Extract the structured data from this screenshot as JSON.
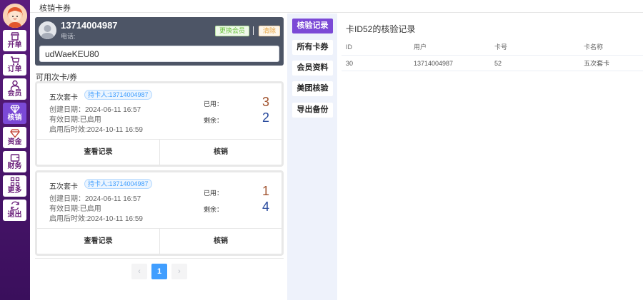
{
  "topbar": {
    "title": "核销卡券"
  },
  "sidebar": {
    "items": [
      {
        "label": "开单",
        "icon": "shop-icon"
      },
      {
        "label": "订单",
        "icon": "cart-icon"
      },
      {
        "label": "会员",
        "icon": "user-icon"
      },
      {
        "label": "核销",
        "icon": "diamond-icon",
        "active": true
      },
      {
        "label": "资金",
        "icon": "gem-icon"
      },
      {
        "label": "财务",
        "icon": "wallet-icon"
      },
      {
        "label": "更多",
        "icon": "grid-icon"
      },
      {
        "label": "退出",
        "icon": "refresh-icon"
      }
    ]
  },
  "member": {
    "phone": "13714004987",
    "tel_label": "电话:",
    "swap_label": "更换会员",
    "clear_label": "清除",
    "code_value": "udWaeKEU80"
  },
  "vouchers_section": {
    "label": "可用次卡/券"
  },
  "vouchers": [
    {
      "name": "五次套卡",
      "holder": "持卡人:13714004987",
      "created": "创建日期：2024-06-11 16:57",
      "valid": "有效日期:已启用",
      "expire": "启用后时效:2024-10-11 16:59",
      "used_label": "已用：",
      "used": "3",
      "remaining_label": "剩余：",
      "remaining": "2",
      "view_label": "查看记录",
      "redeem_label": "核销"
    },
    {
      "name": "五次套卡",
      "holder": "持卡人:13714004987",
      "created": "创建日期：2024-06-11 16:57",
      "valid": "有效日期:已启用",
      "expire": "启用后时效:2024-10-11 16:59",
      "used_label": "已用：",
      "used": "1",
      "remaining_label": "剩余：",
      "remaining": "4",
      "view_label": "查看记录",
      "redeem_label": "核销"
    }
  ],
  "pagination": {
    "prev": "‹",
    "current": "1",
    "next": "›"
  },
  "tabs": [
    {
      "label": "核验记录",
      "active": true
    },
    {
      "label": "所有卡券"
    },
    {
      "label": "会员资料"
    },
    {
      "label": "美团核验"
    },
    {
      "label": "导出备份"
    }
  ],
  "records": {
    "title": "卡ID52的核验记录",
    "columns": [
      "ID",
      "用户",
      "卡号",
      "卡名称"
    ],
    "rows": [
      [
        "30",
        "13714004987",
        "52",
        "五次套卡"
      ]
    ]
  },
  "colors": {
    "sidebar": "#4a1470",
    "accent": "#7b49d6",
    "member_card": "#4d5566",
    "used_number": "#a0522d",
    "remaining_number": "#2b4c9e",
    "page_active": "#409eff"
  }
}
